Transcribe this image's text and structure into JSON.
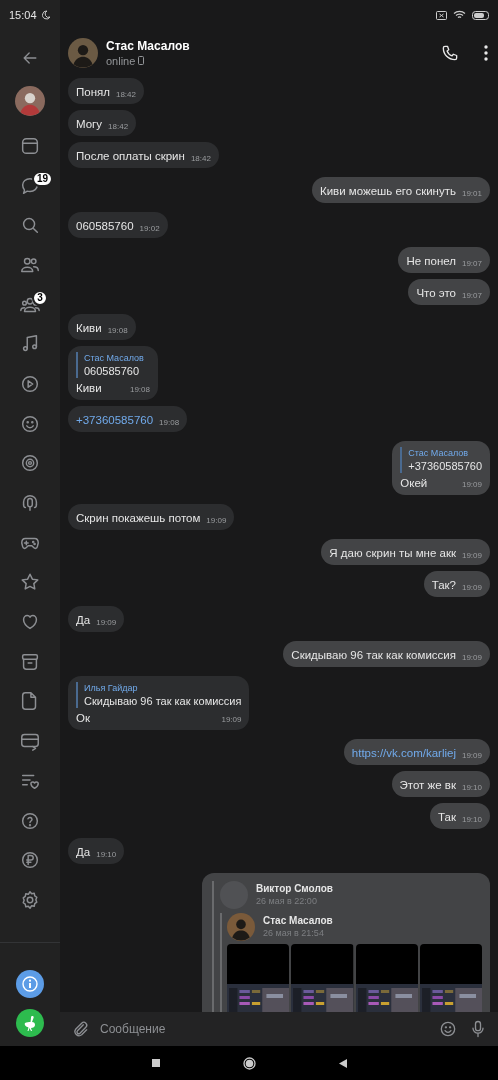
{
  "status_bar": {
    "time": "15:04"
  },
  "sidebar": {
    "items": [
      {
        "kind": "window"
      },
      {
        "kind": "chat",
        "badge": "19"
      },
      {
        "kind": "search"
      },
      {
        "kind": "friends"
      },
      {
        "kind": "groups",
        "badge": "3"
      },
      {
        "kind": "music"
      },
      {
        "kind": "play"
      },
      {
        "kind": "smile"
      },
      {
        "kind": "target"
      },
      {
        "kind": "podcast"
      },
      {
        "kind": "gamepad"
      },
      {
        "kind": "star"
      },
      {
        "kind": "heart"
      },
      {
        "kind": "archive"
      },
      {
        "kind": "document"
      },
      {
        "kind": "card"
      },
      {
        "kind": "list"
      },
      {
        "kind": "help"
      },
      {
        "kind": "ruble"
      },
      {
        "kind": "settings"
      }
    ]
  },
  "header": {
    "name": "Стас Масалов",
    "status": "online"
  },
  "messages": [
    {
      "outgoing": false,
      "kind": "text",
      "text": "Понял",
      "time": "18:42"
    },
    {
      "outgoing": false,
      "kind": "text",
      "text": "Могу",
      "time": "18:42"
    },
    {
      "outgoing": false,
      "kind": "text",
      "text": "После оплаты скрин",
      "time": "18:42"
    },
    {
      "outgoing": true,
      "kind": "text",
      "text": "Киви можешь его скинуть",
      "time": "19:01"
    },
    {
      "outgoing": false,
      "kind": "text",
      "text": "060585760",
      "time": "19:02"
    },
    {
      "outgoing": true,
      "kind": "text",
      "text": "Не понел",
      "time": "19:07"
    },
    {
      "outgoing": true,
      "kind": "text",
      "text": "Что это",
      "time": "19:07"
    },
    {
      "outgoing": false,
      "kind": "text",
      "text": "Киви",
      "time": "19:08"
    },
    {
      "outgoing": false,
      "kind": "reply",
      "reply": {
        "author": "Стас Масалов",
        "text": "060585760"
      },
      "text": "Киви",
      "time": "19:08"
    },
    {
      "outgoing": false,
      "kind": "link",
      "text": "+37360585760",
      "time": "19:08"
    },
    {
      "outgoing": true,
      "kind": "reply",
      "reply": {
        "author": "Стас Масалов",
        "text": "+37360585760"
      },
      "text": "Окей",
      "time": "19:09"
    },
    {
      "outgoing": false,
      "kind": "text",
      "text": "Скрин покажешь потом",
      "time": "19:09"
    },
    {
      "outgoing": true,
      "kind": "text",
      "text": "Я даю скрин ты мне акк",
      "time": "19:09"
    },
    {
      "outgoing": true,
      "kind": "text",
      "text": "Так?",
      "time": "19:09"
    },
    {
      "outgoing": false,
      "kind": "text",
      "text": "Да",
      "time": "19:09"
    },
    {
      "outgoing": true,
      "kind": "text",
      "text": "Скидываю 96 так как комиссия",
      "time": "19:09"
    },
    {
      "outgoing": false,
      "kind": "reply",
      "reply": {
        "author": "Илья Гайдар",
        "text": "Скидываю 96 так как комиссия"
      },
      "text": "Ок",
      "time": "19:09"
    },
    {
      "outgoing": true,
      "kind": "link",
      "text": "https://vk.com/karliej",
      "time": "19:09"
    },
    {
      "outgoing": true,
      "kind": "text",
      "text": "Этот же вк",
      "time": "19:10"
    },
    {
      "outgoing": true,
      "kind": "text",
      "text": "Так",
      "time": "19:10"
    },
    {
      "outgoing": false,
      "kind": "text",
      "text": "Да",
      "time": "19:10"
    },
    {
      "outgoing": true,
      "kind": "forward",
      "forward": {
        "author": "Виктор Смолов",
        "date": "26 мая в 22:00",
        "inner_author": "Стас Масалов",
        "inner_date": "26 мая в 21:54"
      }
    }
  ],
  "composer": {
    "placeholder": "Сообщение"
  }
}
